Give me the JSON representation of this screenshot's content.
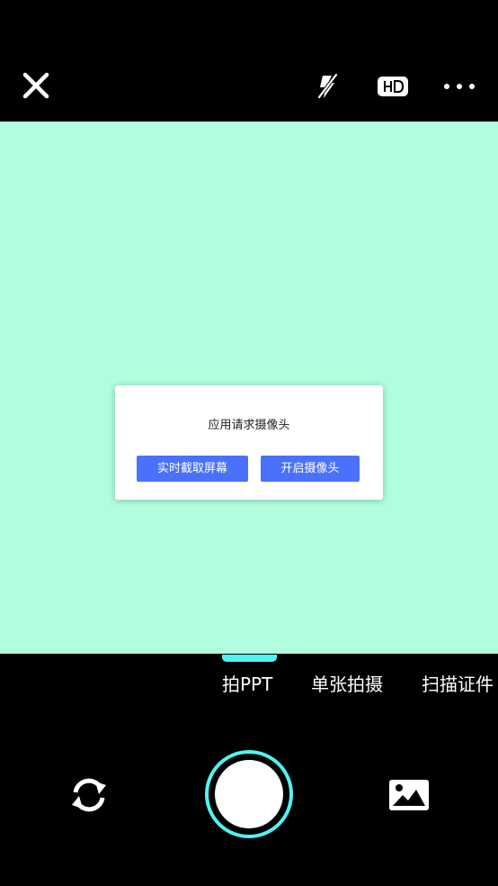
{
  "top_bar": {
    "close_icon": "close-icon",
    "flash_icon": "flash-off-icon",
    "hd_label": "HD",
    "more_icon": "more-dots-icon"
  },
  "viewfinder": {
    "background": "#b0fedd"
  },
  "dialog": {
    "title": "应用请求摄像头",
    "capture_screen_label": "实时截取屏幕",
    "open_camera_label": "开启摄像头",
    "button_color": "#4a71fb"
  },
  "modes": {
    "active_index": 0,
    "tabs": [
      {
        "label": "拍PPT"
      },
      {
        "label": "单张拍摄"
      },
      {
        "label": "扫描证件"
      }
    ],
    "accent": "#4ff4f2"
  },
  "bottom_bar": {
    "switch_camera_icon": "switch-camera-icon",
    "shutter_icon": "shutter-button",
    "gallery_icon": "gallery-icon"
  }
}
